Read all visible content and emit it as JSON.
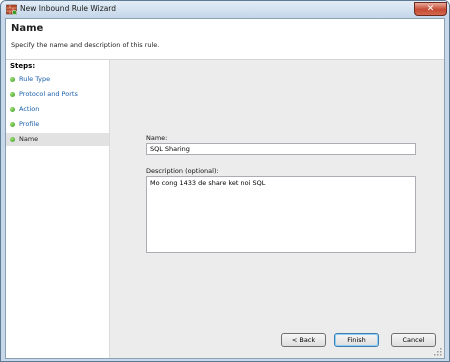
{
  "window": {
    "title": "New Inbound Rule Wizard",
    "close_glyph": "✕"
  },
  "header": {
    "title": "Name",
    "subtitle": "Specify the name and description of this rule."
  },
  "steps": {
    "heading": "Steps:",
    "items": [
      {
        "label": "Rule Type",
        "active": false
      },
      {
        "label": "Protocol and Ports",
        "active": false
      },
      {
        "label": "Action",
        "active": false
      },
      {
        "label": "Profile",
        "active": false
      },
      {
        "label": "Name",
        "active": true
      }
    ]
  },
  "form": {
    "name_label": "Name:",
    "name_value": "SQL Sharing",
    "description_label": "Description (optional):",
    "description_value": "Mo cong 1433 de share ket noi SQL"
  },
  "buttons": {
    "back": "< Back",
    "finish": "Finish",
    "cancel": "Cancel"
  },
  "colors": {
    "step_link": "#1a5ea8",
    "step_dot": "#2f9a18",
    "close_button": "#c54a33"
  }
}
